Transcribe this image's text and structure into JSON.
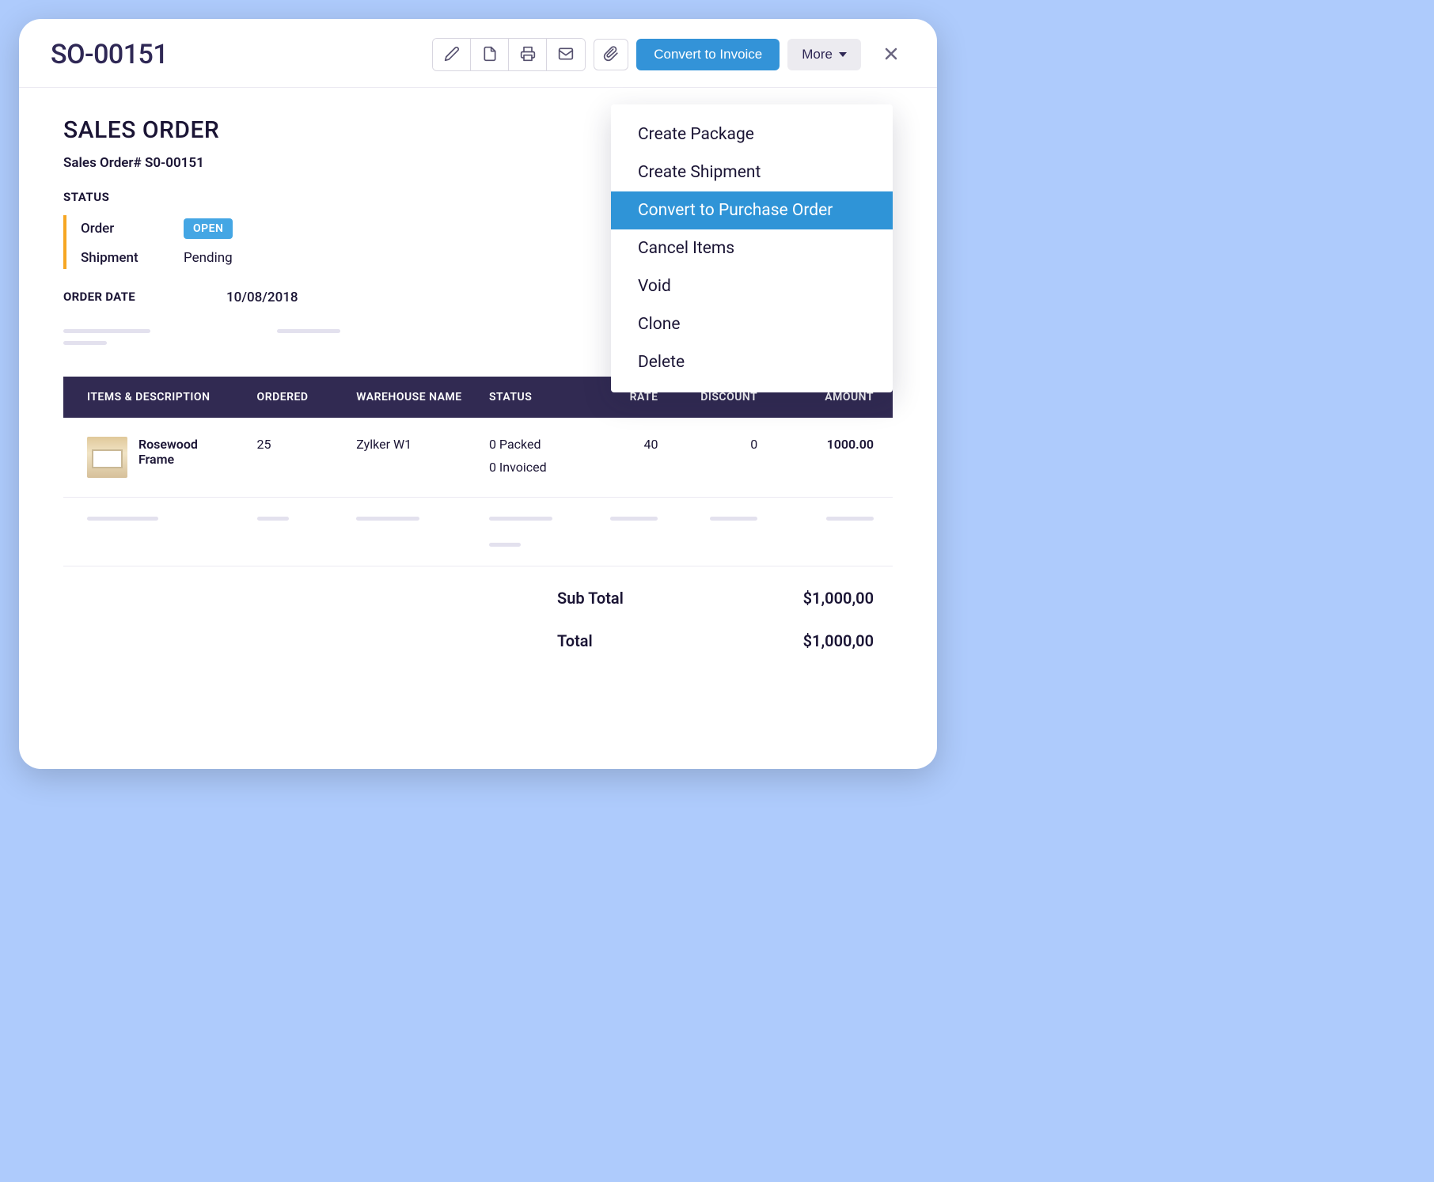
{
  "header": {
    "title": "SO-00151",
    "convert_label": "Convert to Invoice",
    "more_label": "More"
  },
  "dropdown": {
    "items": [
      {
        "label": "Create Package",
        "active": false
      },
      {
        "label": "Create Shipment",
        "active": false
      },
      {
        "label": "Convert to Purchase Order",
        "active": true
      },
      {
        "label": "Cancel Items",
        "active": false
      },
      {
        "label": "Void",
        "active": false
      },
      {
        "label": "Clone",
        "active": false
      },
      {
        "label": "Delete",
        "active": false
      }
    ]
  },
  "order": {
    "heading": "SALES ORDER",
    "number_label": "Sales Order# S0-00151",
    "status_heading": "STATUS",
    "status_rows": {
      "order_key": "Order",
      "order_badge": "OPEN",
      "shipment_key": "Shipment",
      "shipment_value": "Pending"
    },
    "date_key": "ORDER DATE",
    "date_value": "10/08/2018"
  },
  "table": {
    "headers": {
      "items": "ITEMS & DESCRIPTION",
      "ordered": "ORDERED",
      "warehouse": "WAREHOUSE NAME",
      "status": "STATUS",
      "rate": "RATE",
      "discount": "DISCOUNT",
      "amount": "AMOUNT"
    },
    "rows": [
      {
        "name": "Rosewood Frame",
        "ordered": "25",
        "warehouse": "Zylker W1",
        "status_packed": "0 Packed",
        "status_invoiced": "0 Invoiced",
        "rate": "40",
        "discount": "0",
        "amount": "1000.00"
      }
    ]
  },
  "totals": {
    "subtotal_label": "Sub Total",
    "subtotal_value": "$1,000,00",
    "total_label": "Total",
    "total_value": "$1,000,00"
  }
}
